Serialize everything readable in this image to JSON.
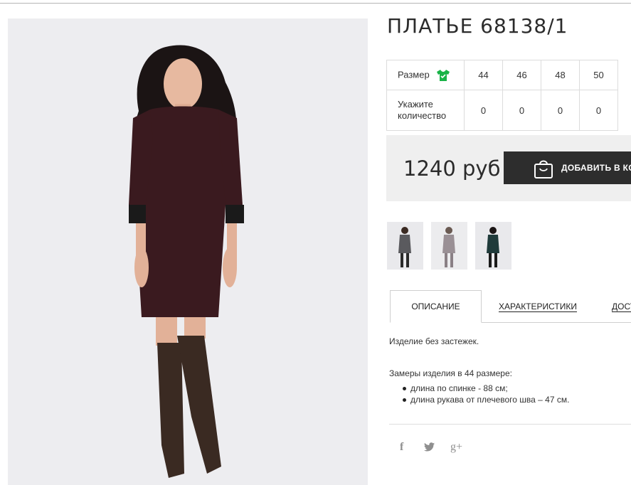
{
  "product": {
    "title": "ПЛАТЬЕ 68138/1"
  },
  "sizes": {
    "size_label": "Размер",
    "size_icon": "tshirt-icon",
    "values": [
      "44",
      "46",
      "48",
      "50"
    ],
    "quantity_label": "Укажите количество",
    "quantities": [
      "0",
      "0",
      "0",
      "0"
    ]
  },
  "purchase": {
    "price": "1240 руб",
    "add_to_cart": "ДОБАВИТЬ В КОРЗИНУ",
    "cart_icon": "shopping-bag-icon"
  },
  "tabs": [
    "ОПИСАНИЕ",
    "ХАРАКТЕРИСТИКИ",
    "ДОСТАВКА"
  ],
  "description": {
    "text1": "Изделие без застежек.",
    "text2": "Замеры изделия в 44 размере:",
    "bullets": [
      "длина по спинке - 88 см;",
      "длина рукава от плечевого шва – 47 см."
    ]
  },
  "social": {
    "icons": [
      "facebook-icon",
      "twitter-icon",
      "google-plus-icon"
    ],
    "facebook_glyph": "f",
    "google_glyph": "g+"
  },
  "colors": {
    "accent_green": "#19b347",
    "button_dark": "#2d2d2d",
    "price_bg": "#efefef"
  }
}
